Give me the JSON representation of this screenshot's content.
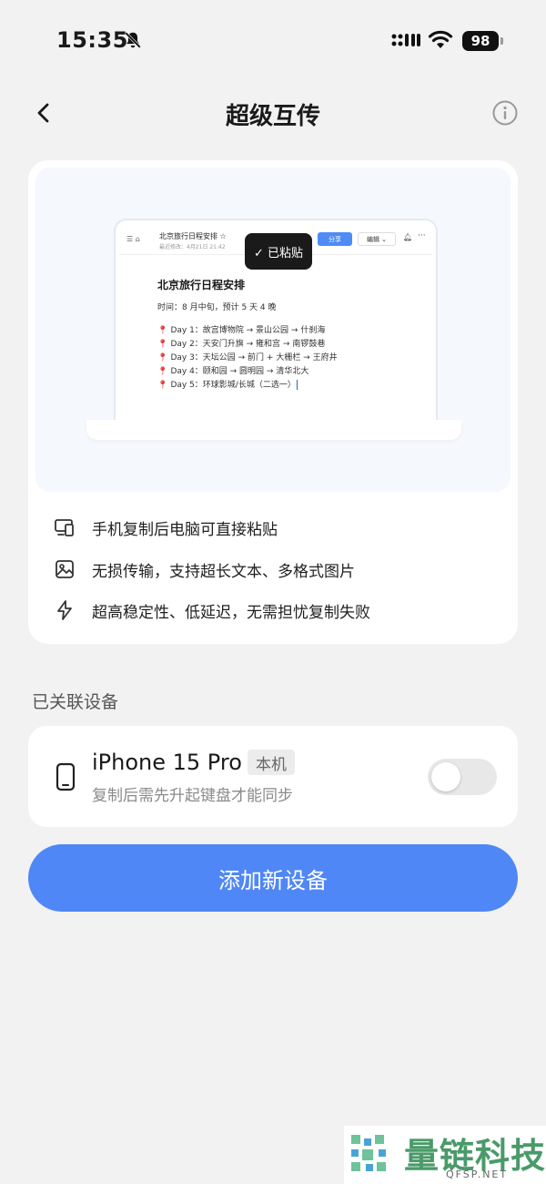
{
  "status_bar": {
    "time": "15:35",
    "battery": "98"
  },
  "nav": {
    "title": "超级互传"
  },
  "preview": {
    "doc_name": "北京旅行日程安排 ☆",
    "doc_meta": "最近修改：4月21日 21:42",
    "share_label": "分享",
    "edit_label": "编辑",
    "pasted_label": "✓ 已粘贴",
    "doc_title": "北京旅行日程安排",
    "doc_time": "时间：8 月中旬，预计 5 天 4 晚",
    "days": [
      "Day 1：故宫博物院 → 景山公园 → 什刹海",
      "Day 2：天安门升旗 → 雍和宫 → 南锣鼓巷",
      "Day 3：天坛公园 → 前门 + 大栅栏 → 王府井",
      "Day 4：颐和园 → 圆明园 → 清华北大",
      "Day 5：环球影城/长城（二选一）"
    ]
  },
  "features": [
    {
      "icon": "devices-icon",
      "text": "手机复制后电脑可直接粘贴"
    },
    {
      "icon": "image-icon",
      "text": "无损传输，支持超长文本、多格式图片"
    },
    {
      "icon": "lightning-icon",
      "text": "超高稳定性、低延迟，无需担忧复制失败"
    }
  ],
  "devices": {
    "section_label": "已关联设备",
    "items": [
      {
        "name": "iPhone 15 Pro",
        "badge": "本机",
        "description": "复制后需先升起键盘才能同步",
        "enabled": false
      }
    ]
  },
  "add_button": {
    "label": "添加新设备"
  },
  "watermark": {
    "text": "量链科技",
    "url": "QFSP.NET"
  },
  "colors": {
    "accent": "#4f87f6",
    "background": "#f2f2f2",
    "card": "#ffffff",
    "pin": "#e0403a"
  }
}
